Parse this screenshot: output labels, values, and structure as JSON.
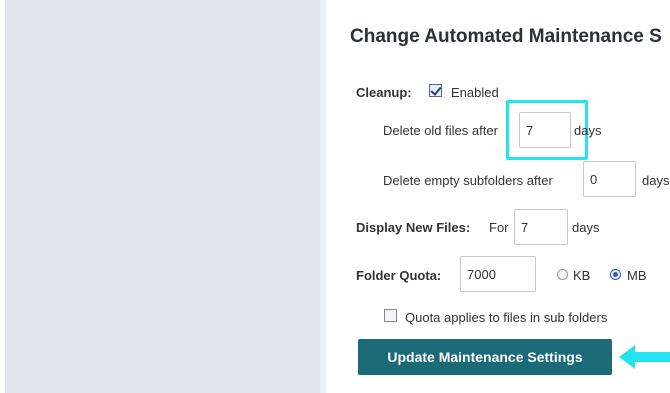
{
  "colors": {
    "accent_button": "#1a6a78",
    "highlight": "#22e3ee",
    "arrow": "#22e3ee",
    "sidebar_bg": "#dfe6ec"
  },
  "page": {
    "title": "Change Automated Maintenance S"
  },
  "cleanup": {
    "label": "Cleanup:",
    "enabled_checked": true,
    "enabled_label": "Enabled",
    "delete_old_prefix": "Delete old files after",
    "delete_old_value": "7",
    "delete_old_suffix": "days",
    "delete_empty_prefix": "Delete empty subfolders after",
    "delete_empty_value": "0",
    "delete_empty_suffix": "days"
  },
  "display_new": {
    "label": "Display New Files:",
    "prefix": "For",
    "value": "7",
    "suffix": "days"
  },
  "quota": {
    "label": "Folder Quota:",
    "value": "7000",
    "unit_options": [
      "KB",
      "MB"
    ],
    "selected_unit": "MB",
    "subfolders_checked": false,
    "subfolders_label": "Quota applies to files in sub folders"
  },
  "actions": {
    "update_button": "Update Maintenance Settings"
  }
}
